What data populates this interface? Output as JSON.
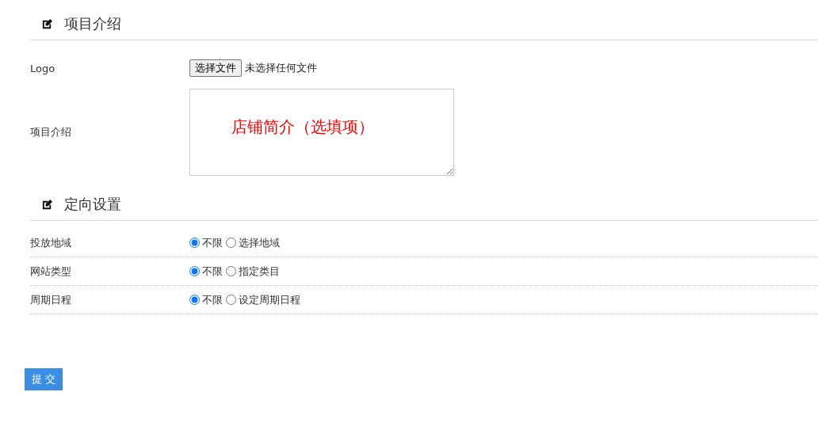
{
  "sections": [
    {
      "title": "项目介绍",
      "fields": [
        {
          "kind": "file",
          "label": "Logo",
          "button": "选择文件",
          "status": "未选择任何文件"
        },
        {
          "kind": "textarea",
          "label": "项目介绍",
          "value": "店铺简介（选填项）"
        }
      ]
    },
    {
      "title": "定向设置",
      "fields": [
        {
          "kind": "radio",
          "label": "投放地域",
          "options": [
            {
              "label": "不限",
              "selected": true
            },
            {
              "label": "选择地域",
              "selected": false
            }
          ]
        },
        {
          "kind": "radio",
          "label": "网站类型",
          "options": [
            {
              "label": "不限",
              "selected": true
            },
            {
              "label": "指定类目",
              "selected": false
            }
          ]
        },
        {
          "kind": "radio",
          "label": "周期日程",
          "options": [
            {
              "label": "不限",
              "selected": true
            },
            {
              "label": "设定周期日程",
              "selected": false
            }
          ]
        }
      ]
    }
  ],
  "submit": "提 交"
}
